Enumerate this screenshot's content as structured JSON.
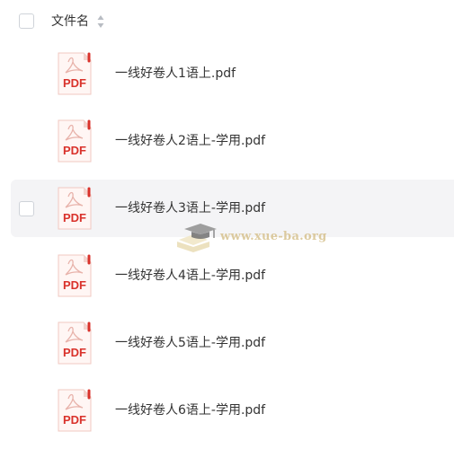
{
  "header": {
    "column_label": "文件名",
    "sort_icon": "sort-updown-icon"
  },
  "files": [
    {
      "name": "一线好卷人1语上.pdf",
      "icon": "pdf-file-icon",
      "icon_label": "PDF"
    },
    {
      "name": "一线好卷人2语上-学用.pdf",
      "icon": "pdf-file-icon",
      "icon_label": "PDF"
    },
    {
      "name": "一线好卷人3语上-学用.pdf",
      "icon": "pdf-file-icon",
      "icon_label": "PDF"
    },
    {
      "name": "一线好卷人4语上-学用.pdf",
      "icon": "pdf-file-icon",
      "icon_label": "PDF"
    },
    {
      "name": "一线好卷人5语上-学用.pdf",
      "icon": "pdf-file-icon",
      "icon_label": "PDF"
    },
    {
      "name": "一线好卷人6语上-学用.pdf",
      "icon": "pdf-file-icon",
      "icon_label": "PDF"
    }
  ],
  "watermark": {
    "text": "www.xue-ba.org"
  },
  "colors": {
    "pdf_red": "#d9322b",
    "row_hover": "#f4f4f6",
    "text": "#333333"
  }
}
